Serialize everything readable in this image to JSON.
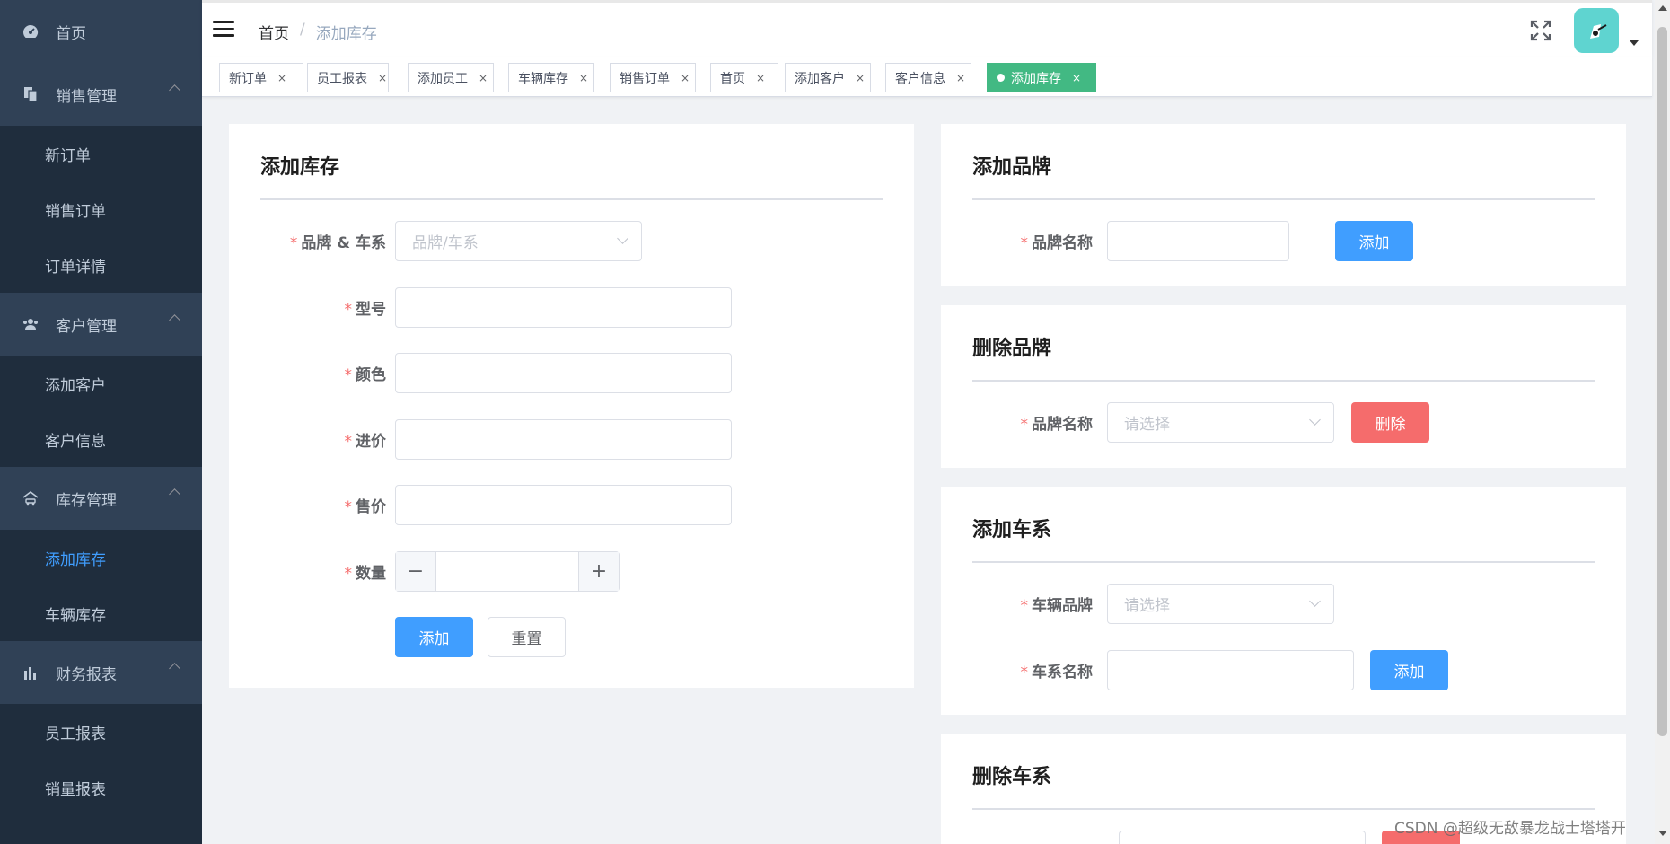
{
  "sidebar": {
    "home": "首页",
    "groups": [
      {
        "label": "销售管理",
        "icon": "file-copy-icon",
        "items": [
          "新订单",
          "销售订单",
          "订单详情"
        ]
      },
      {
        "label": "客户管理",
        "icon": "users-icon",
        "items": [
          "添加客户",
          "客户信息"
        ]
      },
      {
        "label": "库存管理",
        "icon": "car-warehouse-icon",
        "items": [
          "添加库存",
          "车辆库存"
        ]
      },
      {
        "label": "财务报表",
        "icon": "bar-chart-icon",
        "items": [
          "员工报表",
          "销量报表"
        ]
      }
    ],
    "active_item": "添加库存"
  },
  "header": {
    "breadcrumb_home": "首页",
    "breadcrumb_sep": "/",
    "breadcrumb_current": "添加库存"
  },
  "tags": [
    "新订单",
    "员工报表",
    "添加员工",
    "车辆库存",
    "销售订单",
    "首页",
    "添加客户",
    "客户信息",
    "添加库存"
  ],
  "tag_close": "×",
  "add_stock": {
    "title": "添加库存",
    "brand_series_label": "品牌 & 车系",
    "brand_series_placeholder": "品牌/车系",
    "model_label": "型号",
    "color_label": "颜色",
    "cost_label": "进价",
    "price_label": "售价",
    "quantity_label": "数量",
    "minus": "−",
    "plus": "+",
    "add_button": "添加",
    "reset_button": "重置"
  },
  "add_brand": {
    "title": "添加品牌",
    "name_label": "品牌名称",
    "add_button": "添加"
  },
  "delete_brand": {
    "title": "删除品牌",
    "name_label": "品牌名称",
    "placeholder": "请选择",
    "delete_button": "删除"
  },
  "add_series": {
    "title": "添加车系",
    "brand_label": "车辆品牌",
    "brand_placeholder": "请选择",
    "series_label": "车系名称",
    "add_button": "添加"
  },
  "delete_series": {
    "title": "删除车系"
  },
  "watermark": "CSDN @超级无敌暴龙战士塔塔开",
  "colors": {
    "primary": "#409eff",
    "danger": "#f56c6c",
    "active_tag": "#42b983",
    "sidebar": "#304156"
  }
}
